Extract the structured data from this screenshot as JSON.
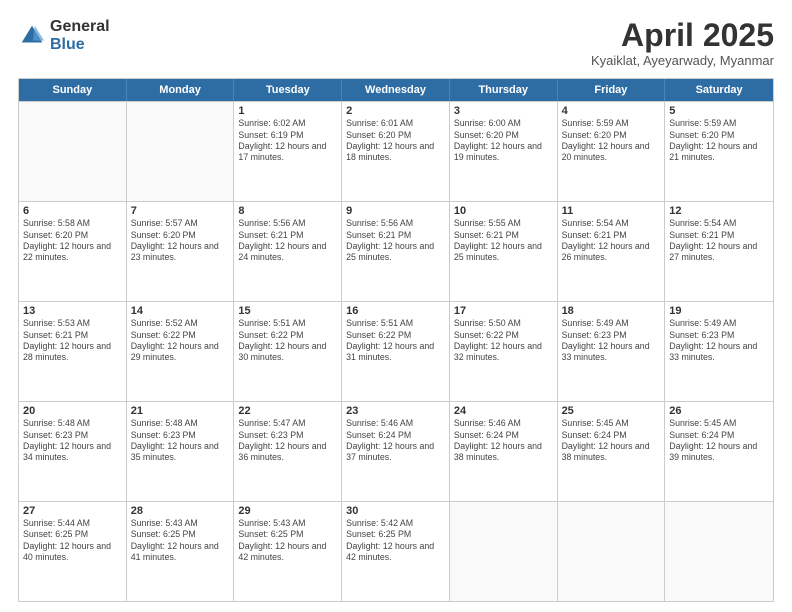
{
  "logo": {
    "general": "General",
    "blue": "Blue"
  },
  "title": "April 2025",
  "location": "Kyaiklat, Ayeyarwady, Myanmar",
  "header_days": [
    "Sunday",
    "Monday",
    "Tuesday",
    "Wednesday",
    "Thursday",
    "Friday",
    "Saturday"
  ],
  "weeks": [
    [
      {
        "day": "",
        "info": ""
      },
      {
        "day": "",
        "info": ""
      },
      {
        "day": "1",
        "info": "Sunrise: 6:02 AM\nSunset: 6:19 PM\nDaylight: 12 hours and 17 minutes."
      },
      {
        "day": "2",
        "info": "Sunrise: 6:01 AM\nSunset: 6:20 PM\nDaylight: 12 hours and 18 minutes."
      },
      {
        "day": "3",
        "info": "Sunrise: 6:00 AM\nSunset: 6:20 PM\nDaylight: 12 hours and 19 minutes."
      },
      {
        "day": "4",
        "info": "Sunrise: 5:59 AM\nSunset: 6:20 PM\nDaylight: 12 hours and 20 minutes."
      },
      {
        "day": "5",
        "info": "Sunrise: 5:59 AM\nSunset: 6:20 PM\nDaylight: 12 hours and 21 minutes."
      }
    ],
    [
      {
        "day": "6",
        "info": "Sunrise: 5:58 AM\nSunset: 6:20 PM\nDaylight: 12 hours and 22 minutes."
      },
      {
        "day": "7",
        "info": "Sunrise: 5:57 AM\nSunset: 6:20 PM\nDaylight: 12 hours and 23 minutes."
      },
      {
        "day": "8",
        "info": "Sunrise: 5:56 AM\nSunset: 6:21 PM\nDaylight: 12 hours and 24 minutes."
      },
      {
        "day": "9",
        "info": "Sunrise: 5:56 AM\nSunset: 6:21 PM\nDaylight: 12 hours and 25 minutes."
      },
      {
        "day": "10",
        "info": "Sunrise: 5:55 AM\nSunset: 6:21 PM\nDaylight: 12 hours and 25 minutes."
      },
      {
        "day": "11",
        "info": "Sunrise: 5:54 AM\nSunset: 6:21 PM\nDaylight: 12 hours and 26 minutes."
      },
      {
        "day": "12",
        "info": "Sunrise: 5:54 AM\nSunset: 6:21 PM\nDaylight: 12 hours and 27 minutes."
      }
    ],
    [
      {
        "day": "13",
        "info": "Sunrise: 5:53 AM\nSunset: 6:21 PM\nDaylight: 12 hours and 28 minutes."
      },
      {
        "day": "14",
        "info": "Sunrise: 5:52 AM\nSunset: 6:22 PM\nDaylight: 12 hours and 29 minutes."
      },
      {
        "day": "15",
        "info": "Sunrise: 5:51 AM\nSunset: 6:22 PM\nDaylight: 12 hours and 30 minutes."
      },
      {
        "day": "16",
        "info": "Sunrise: 5:51 AM\nSunset: 6:22 PM\nDaylight: 12 hours and 31 minutes."
      },
      {
        "day": "17",
        "info": "Sunrise: 5:50 AM\nSunset: 6:22 PM\nDaylight: 12 hours and 32 minutes."
      },
      {
        "day": "18",
        "info": "Sunrise: 5:49 AM\nSunset: 6:23 PM\nDaylight: 12 hours and 33 minutes."
      },
      {
        "day": "19",
        "info": "Sunrise: 5:49 AM\nSunset: 6:23 PM\nDaylight: 12 hours and 33 minutes."
      }
    ],
    [
      {
        "day": "20",
        "info": "Sunrise: 5:48 AM\nSunset: 6:23 PM\nDaylight: 12 hours and 34 minutes."
      },
      {
        "day": "21",
        "info": "Sunrise: 5:48 AM\nSunset: 6:23 PM\nDaylight: 12 hours and 35 minutes."
      },
      {
        "day": "22",
        "info": "Sunrise: 5:47 AM\nSunset: 6:23 PM\nDaylight: 12 hours and 36 minutes."
      },
      {
        "day": "23",
        "info": "Sunrise: 5:46 AM\nSunset: 6:24 PM\nDaylight: 12 hours and 37 minutes."
      },
      {
        "day": "24",
        "info": "Sunrise: 5:46 AM\nSunset: 6:24 PM\nDaylight: 12 hours and 38 minutes."
      },
      {
        "day": "25",
        "info": "Sunrise: 5:45 AM\nSunset: 6:24 PM\nDaylight: 12 hours and 38 minutes."
      },
      {
        "day": "26",
        "info": "Sunrise: 5:45 AM\nSunset: 6:24 PM\nDaylight: 12 hours and 39 minutes."
      }
    ],
    [
      {
        "day": "27",
        "info": "Sunrise: 5:44 AM\nSunset: 6:25 PM\nDaylight: 12 hours and 40 minutes."
      },
      {
        "day": "28",
        "info": "Sunrise: 5:43 AM\nSunset: 6:25 PM\nDaylight: 12 hours and 41 minutes."
      },
      {
        "day": "29",
        "info": "Sunrise: 5:43 AM\nSunset: 6:25 PM\nDaylight: 12 hours and 42 minutes."
      },
      {
        "day": "30",
        "info": "Sunrise: 5:42 AM\nSunset: 6:25 PM\nDaylight: 12 hours and 42 minutes."
      },
      {
        "day": "",
        "info": ""
      },
      {
        "day": "",
        "info": ""
      },
      {
        "day": "",
        "info": ""
      }
    ]
  ]
}
